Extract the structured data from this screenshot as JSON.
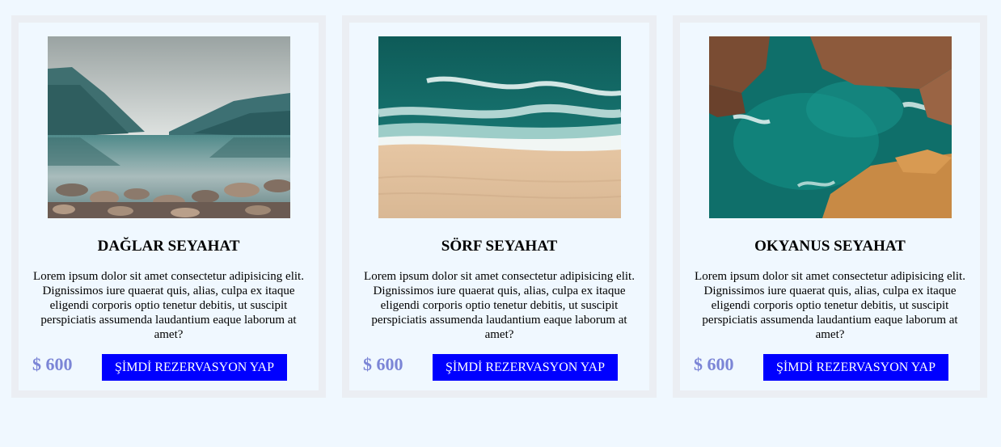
{
  "cards": [
    {
      "image_icon": "mountain-lake-photo",
      "title": "DAĞLAR SEYAHAT",
      "description": "Lorem ipsum dolor sit amet consectetur adipisicing elit. Dignissimos iure quaerat quis, alias, culpa ex itaque eligendi corporis optio tenetur debitis, ut suscipit perspiciatis assumenda laudantium eaque laborum at amet?",
      "price": "$ 600",
      "button_label": "ŞİMDİ REZERVASYON YAP"
    },
    {
      "image_icon": "surf-beach-photo",
      "title": "SÖRF SEYAHAT",
      "description": "Lorem ipsum dolor sit amet consectetur adipisicing elit. Dignissimos iure quaerat quis, alias, culpa ex itaque eligendi corporis optio tenetur debitis, ut suscipit perspiciatis assumenda laudantium eaque laborum at amet?",
      "price": "$ 600",
      "button_label": "ŞİMDİ REZERVASYON YAP"
    },
    {
      "image_icon": "ocean-rocks-photo",
      "title": "OKYANUS SEYAHAT",
      "description": "Lorem ipsum dolor sit amet consectetur adipisicing elit. Dignissimos iure quaerat quis, alias, culpa ex itaque eligendi corporis optio tenetur debitis, ut suscipit perspiciatis assumenda laudantium eaque laborum at amet?",
      "price": "$ 600",
      "button_label": "ŞİMDİ REZERVASYON YAP"
    }
  ],
  "colors": {
    "page_background": "#f0f8ff",
    "card_border": "#ebeef3",
    "price": "#7b85d6",
    "button_background": "#0000ff",
    "button_text": "#ffffff"
  }
}
